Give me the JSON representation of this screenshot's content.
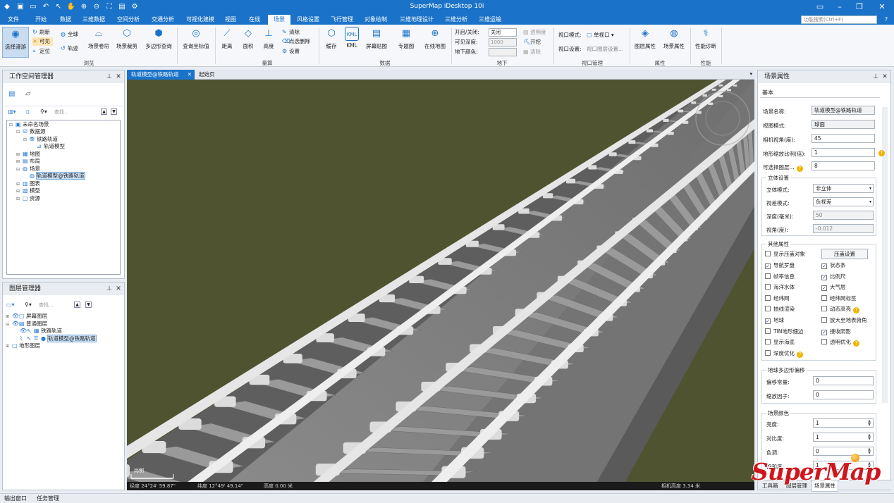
{
  "app": {
    "title": "SuperMap iDesktop 10i"
  },
  "menu": [
    "文件",
    "开始",
    "数据",
    "三维数据",
    "空间分析",
    "交通分析",
    "可视化建模",
    "视图",
    "在线",
    "场景",
    "风格设置",
    "飞行管理",
    "对象绘制",
    "三维地理设计",
    "三维分析",
    "三维运输"
  ],
  "search_placeholder": "功能搜索(Ctrl+F)",
  "ribbon": {
    "select_browse": "选择漫游",
    "refresh": "刷新",
    "visible": "可见",
    "locate": "定位",
    "global": "全球",
    "track": "轨迹",
    "scene_roll": "场景卷帘",
    "scene_clip": "场景裁剪",
    "polygon_query": "多边形查询",
    "query_coords": "查询坐标值",
    "distance": "距离",
    "area": "面积",
    "height": "高度",
    "clear": "清除",
    "pick_delete": "点选删除",
    "settings": "设置",
    "cache": "缓存",
    "kml": "KML",
    "screen_paste": "屏幕贴图",
    "thematic": "专题图",
    "online_map": "在线地图",
    "open_close": "开启/关闭:",
    "open_close_value": "关闭",
    "visible_depth": "可见深度:",
    "visible_depth_value": "1000",
    "underground_color": "地下颜色:",
    "transparency": "透明度",
    "enable": "开挖",
    "clear2": "清除",
    "viewport_mode": "视口模式:",
    "viewport_mode_value": "单视口",
    "viewport_settings": "视口设置:",
    "viewport_layer_settings": "视口图层设置...",
    "layer_props": "图层属性",
    "scene_props": "场景属性",
    "perf_diag": "性能诊断",
    "groups": {
      "browse": "浏览",
      "measure": "量算",
      "data": "数据",
      "underground": "地下",
      "viewport": "视口管理",
      "properties": "属性",
      "performance": "性能"
    }
  },
  "workspace": {
    "title": "工作空间管理器",
    "find_placeholder": "查找...",
    "tree": [
      "未命名场景",
      "数据源",
      "铁路轨道",
      "轨道模型",
      "地图",
      "布局",
      "场景",
      "轨道模型@铁路轨道",
      "图表",
      "模型",
      "资源"
    ]
  },
  "layers": {
    "title": "图层管理器",
    "find_placeholder": "查找...",
    "tree": [
      "屏幕图层",
      "普通图层",
      "铁路轨道",
      "轨道模型@铁路轨道",
      "地形图层"
    ]
  },
  "tabs": [
    "轨道模型@铁路轨道",
    "起始页"
  ],
  "status": {
    "scale": "比例",
    "lon": "经度 24°24' 59.87\"",
    "lat": "纬度 12°49' 49.14\"",
    "elev": "高度 0.00 米",
    "cam": "相机高度 3.34 米"
  },
  "props": {
    "title": "场景属性",
    "tab": "基本",
    "scene_name": "场景名称:",
    "scene_name_value": "轨道模型@铁路轨道",
    "view_mode": "视图模式:",
    "view_mode_value": "球面",
    "fov": "相机视角(度):",
    "fov_value": "45",
    "terrain_scale": "地形缩放比例(倍):",
    "terrain_scale_value": "1",
    "selectable_layers": "可选择图层...",
    "selectable_layers_value": "8",
    "stereo": "立体设置",
    "stereo_mode": "立体模式:",
    "stereo_mode_value": "非立体",
    "parallax": "视差模式:",
    "parallax_value": "负视差",
    "depth": "深度(毫米):",
    "depth_value": "50",
    "view_angle": "视角(度):",
    "view_angle_value": "-0.012",
    "other": "其他属性",
    "show_overlap": "显示压盖对象",
    "overlap_settings": "压盖设置",
    "checks": [
      {
        "label": "导航罗盘",
        "checked": true
      },
      {
        "label": "状态条",
        "checked": true
      },
      {
        "label": "帧率信息",
        "checked": false
      },
      {
        "label": "比例尺",
        "checked": true
      },
      {
        "label": "海洋水体",
        "checked": false
      },
      {
        "label": "大气层",
        "checked": true
      },
      {
        "label": "经纬网",
        "checked": false
      },
      {
        "label": "经纬网标签",
        "checked": false
      },
      {
        "label": "抽线渲染",
        "checked": false
      },
      {
        "label": "动态高亮",
        "checked": false
      },
      {
        "label": "地球",
        "checked": true
      },
      {
        "label": "放大至地表俯角",
        "checked": false
      },
      {
        "label": "TIN地形细边",
        "checked": false
      },
      {
        "label": "接收阴影",
        "checked": true
      },
      {
        "label": "显示海底",
        "checked": false
      },
      {
        "label": "透明优化",
        "checked": false
      },
      {
        "label": "深度优化",
        "checked": false
      }
    ],
    "offset": "地球多边形偏移",
    "offset_const": "偏移常量:",
    "offset_const_value": "0",
    "scale_factor": "缩放因子:",
    "scale_factor_value": "0",
    "color": "场景颜色",
    "brightness": "亮度:",
    "brightness_value": "1",
    "contrast": "对比度:",
    "contrast_value": "1",
    "hue": "色调:",
    "hue_value": "0",
    "saturation": "饱和度:",
    "saturation_value": "1"
  },
  "bottom_tabs": [
    "工具箱",
    "图层管理",
    "场景属性"
  ],
  "footer": [
    "输出窗口",
    "任务管理"
  ],
  "logo": "SuperMap"
}
